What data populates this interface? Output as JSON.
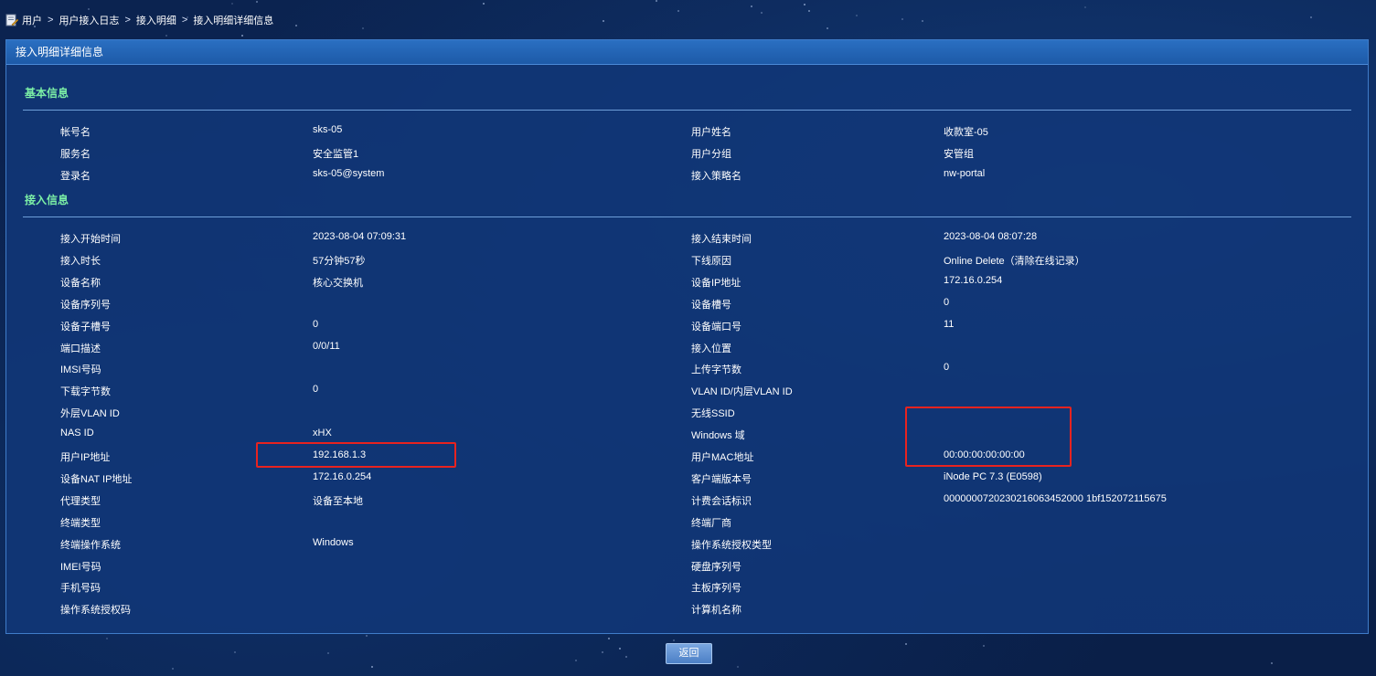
{
  "breadcrumb": {
    "items": [
      "用户",
      "用户接入日志",
      "接入明细",
      "接入明细详细信息"
    ],
    "separator": ">"
  },
  "panel": {
    "title": "接入明细详细信息"
  },
  "basic_info": {
    "title": "基本信息",
    "rows": [
      [
        "帐号名",
        "sks-05",
        "用户姓名",
        "收款室-05"
      ],
      [
        "服务名",
        "安全监管1",
        "用户分组",
        "安管组"
      ],
      [
        "登录名",
        "sks-05@system",
        "接入策略名",
        "nw-portal"
      ]
    ]
  },
  "access_info": {
    "title": "接入信息",
    "rows": [
      [
        "接入开始时间",
        "2023-08-04 07:09:31",
        "接入结束时间",
        "2023-08-04 08:07:28"
      ],
      [
        "接入时长",
        "57分钟57秒",
        "下线原因",
        "Online Delete（清除在线记录）"
      ],
      [
        "设备名称",
        "核心交换机",
        "设备IP地址",
        "172.16.0.254"
      ],
      [
        "设备序列号",
        "",
        "设备槽号",
        "0"
      ],
      [
        "设备子槽号",
        "0",
        "设备端口号",
        "11"
      ],
      [
        "端口描述",
        "0/0/11",
        "接入位置",
        ""
      ],
      [
        "IMSI号码",
        "",
        "上传字节数",
        "0"
      ],
      [
        "下载字节数",
        "0",
        "VLAN ID/内层VLAN ID",
        ""
      ],
      [
        "外层VLAN ID",
        "",
        "无线SSID",
        ""
      ],
      [
        "NAS ID",
        "xHX",
        "Windows 域",
        ""
      ],
      [
        "用户IP地址",
        "192.168.1.3",
        "用户MAC地址",
        "00:00:00:00:00:00"
      ],
      [
        "设备NAT IP地址",
        "172.16.0.254",
        "客户端版本号",
        "iNode PC 7.3 (E0598)"
      ],
      [
        "代理类型",
        "设备至本地",
        "计费会话标识",
        "0000000720230216063452000 1bf152072115675"
      ],
      [
        "终端类型",
        "",
        "终端厂商",
        ""
      ],
      [
        "终端操作系统",
        "Windows",
        "操作系统授权类型",
        ""
      ],
      [
        "IMEI号码",
        "",
        "硬盘序列号",
        ""
      ],
      [
        "手机号码",
        "",
        "主板序列号",
        ""
      ],
      [
        "操作系统授权码",
        "",
        "计算机名称",
        ""
      ]
    ]
  },
  "buttons": {
    "back": "返回"
  },
  "colors": {
    "section_title": "#7cf0a6",
    "highlight_box": "#e8231f",
    "panel_header": "#1d5aa8"
  }
}
